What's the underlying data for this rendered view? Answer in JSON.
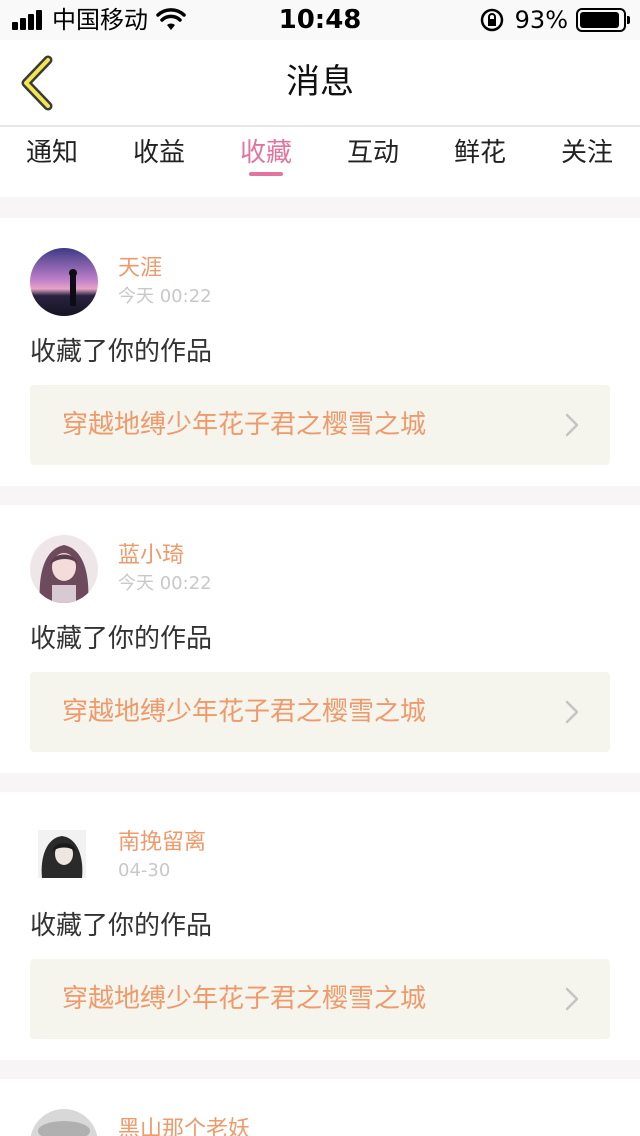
{
  "status": {
    "carrier": "中国移动",
    "time": "10:48",
    "battery": "93%"
  },
  "nav": {
    "title": "消息"
  },
  "tabs": [
    {
      "label": "通知"
    },
    {
      "label": "收益"
    },
    {
      "label": "收藏"
    },
    {
      "label": "互动"
    },
    {
      "label": "鲜花"
    },
    {
      "label": "关注"
    }
  ],
  "active_tab": "收藏",
  "items": [
    {
      "name": "天涯",
      "time": "今天 00:22",
      "action": "收藏了你的作品",
      "work": "穿越地缚少年花子君之樱雪之城"
    },
    {
      "name": "蓝小琦",
      "time": "今天 00:22",
      "action": "收藏了你的作品",
      "work": "穿越地缚少年花子君之樱雪之城"
    },
    {
      "name": "南挽留离",
      "time": "04-30",
      "action": "收藏了你的作品",
      "work": "穿越地缚少年花子君之樱雪之城"
    },
    {
      "name": "黑山那个老妖",
      "time": "",
      "action": "",
      "work": ""
    }
  ],
  "colors": {
    "accent": "#e2749f",
    "name": "#ee9a6b",
    "work_bg": "#f5f5ee"
  }
}
